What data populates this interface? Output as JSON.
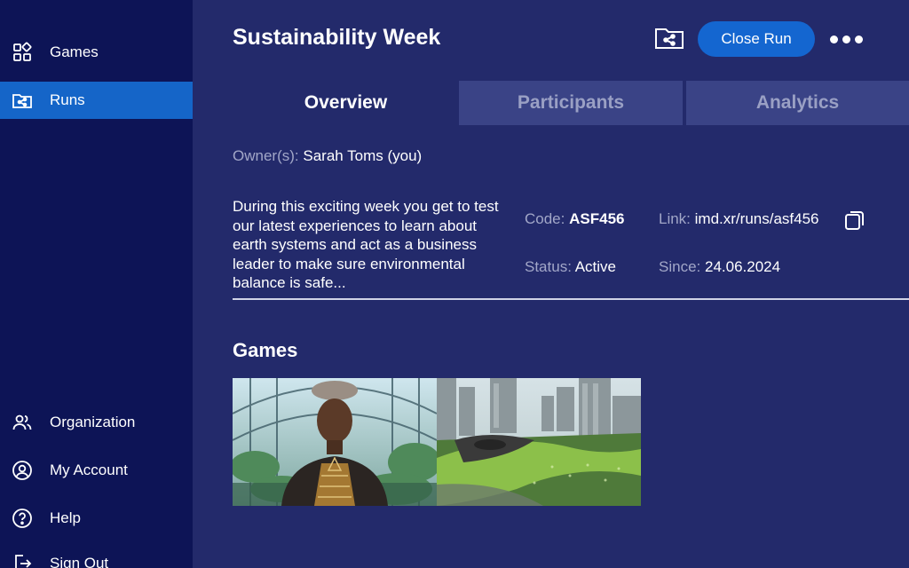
{
  "sidebar": {
    "items": [
      {
        "label": "Games",
        "icon": "games-grid-icon"
      },
      {
        "label": "Runs",
        "icon": "folder-share-icon",
        "active": true
      },
      {
        "label": "Organization",
        "icon": "people-icon"
      },
      {
        "label": "My Account",
        "icon": "account-icon"
      },
      {
        "label": "Help",
        "icon": "help-icon"
      },
      {
        "label": "Sign Out",
        "icon": "sign-out-icon"
      }
    ]
  },
  "header": {
    "title": "Sustainability Week",
    "close_label": "Close Run"
  },
  "tabs": [
    {
      "label": "Overview",
      "active": true
    },
    {
      "label": "Participants",
      "active": false
    },
    {
      "label": "Analytics",
      "active": false
    }
  ],
  "overview": {
    "owner_label": "Owner(s):",
    "owner_value": "Sarah Toms (you)",
    "description": "During this exciting week you get to test our latest experiences to learn about earth systems and act as a business leader to make sure environmental balance is safe...",
    "code_label": "Code:",
    "code_value": "ASF456",
    "link_label": "Link:",
    "link_value": "imd.xr/runs/asf456",
    "status_label": "Status:",
    "status_value": "Active",
    "since_label": "Since:",
    "since_value": "24.06.2024"
  },
  "games": {
    "heading": "Games"
  },
  "colors": {
    "sidebar_bg": "#0d1456",
    "main_bg": "#232a6b",
    "accent": "#1565c8",
    "inactive_tab": "#3a4386"
  }
}
